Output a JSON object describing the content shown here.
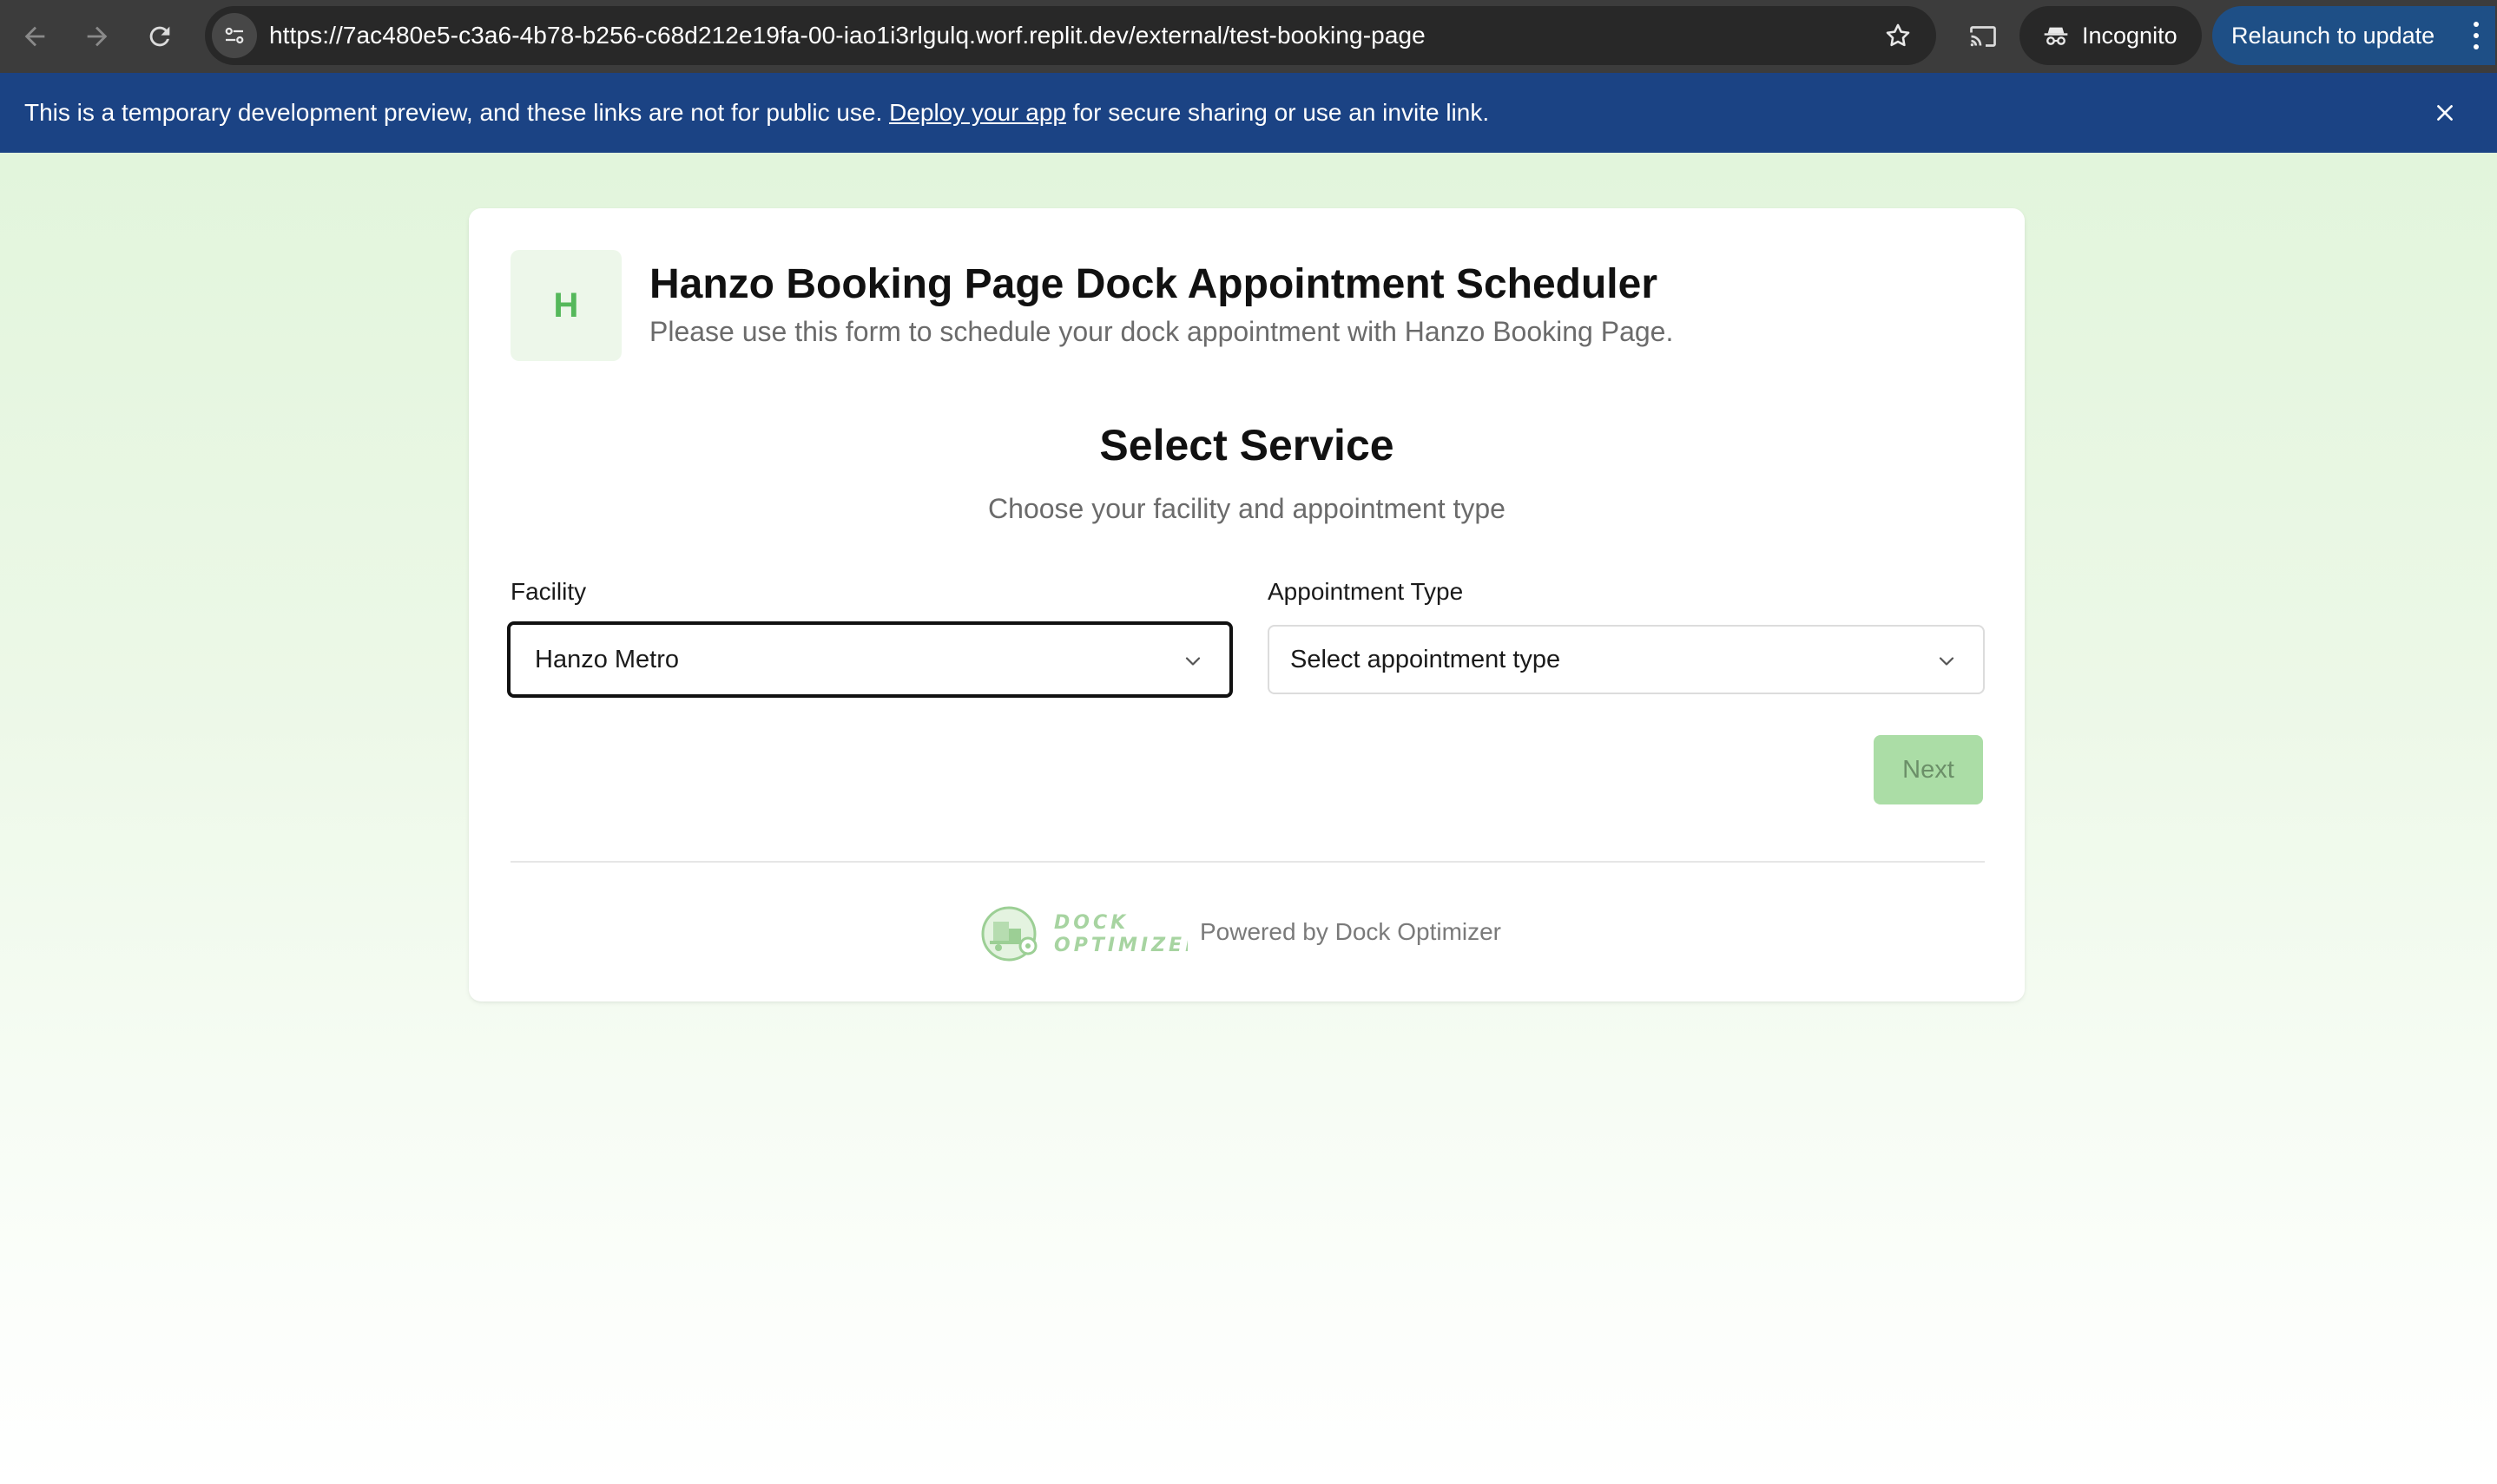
{
  "browser": {
    "url": "https://7ac480e5-c3a6-4b78-b256-c68d212e19fa-00-iao1i3rlgulq.worf.replit.dev/external/test-booking-page",
    "incognito_label": "Incognito",
    "relaunch_label": "Relaunch to update",
    "icons": [
      "back-arrow-icon",
      "forward-arrow-icon",
      "reload-icon",
      "site-info-icon",
      "bookmark-star-icon",
      "cast-icon",
      "incognito-icon",
      "more-vert-icon"
    ]
  },
  "banner": {
    "text_before": "This is a temporary development preview, and these links are not for public use. ",
    "link_text": "Deploy your app",
    "text_after": " for secure sharing or use an invite link.",
    "background": "#1b4384"
  },
  "header": {
    "logo_letter": "H",
    "title": "Hanzo Booking Page Dock Appointment Scheduler",
    "subtitle": "Please use this form to schedule your dock appointment with Hanzo Booking Page."
  },
  "section": {
    "title": "Select Service",
    "subtitle": "Choose your facility and appointment type"
  },
  "form": {
    "facility_label": "Facility",
    "facility_value": "Hanzo Metro",
    "appointment_type_label": "Appointment Type",
    "appointment_type_placeholder": "Select appointment type",
    "next_label": "Next"
  },
  "footer": {
    "logo_text_line1": "DOCK",
    "logo_text_line2": "OPTIMIZER",
    "powered_by": "Powered by Dock Optimizer"
  },
  "colors": {
    "accent_green": "#55b85b",
    "next_disabled_bg": "#abdda6",
    "page_gradient_top": "#e2f5dc"
  }
}
